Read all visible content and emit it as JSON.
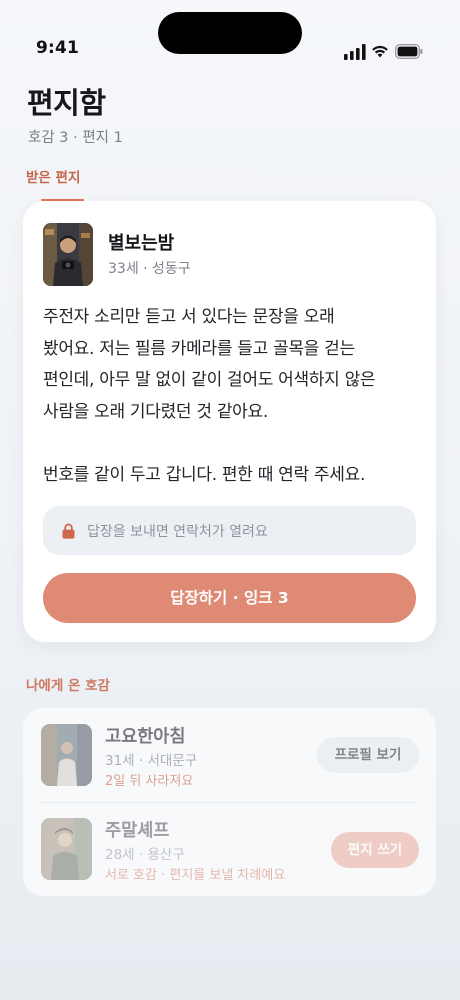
{
  "status_bar": {
    "time": "9:41"
  },
  "header": {
    "title": "편지함",
    "subtitle": "호감 3 · 편지 1"
  },
  "received_section": {
    "label": "받은 편지"
  },
  "letter": {
    "sender": {
      "name": "별보는밤",
      "meta": "33세 · 성동구",
      "avatar": "person-photo"
    },
    "paragraph1": [
      "주전자 소리만 듣고 서 있다는 문장을 오래",
      "봤어요. 저는 필름 카메라를 들고 골목을 걷는",
      "편인데, 아무 말 없이 같이 걸어도 어색하지 않은",
      "사람을 오래 기다렸던 것 같아요."
    ],
    "paragraph2": "번호를 같이 두고 갑니다. 편한 때 연락 주세요.",
    "locked_note": "답장을 보내면 연락처가 열려요",
    "lock_icon": "lock-icon",
    "reply_button": "답장하기 · 잉크 3",
    "accent_color": "#df8a74"
  },
  "likes_section": {
    "label": "나에게 온 호감",
    "items": [
      {
        "name": "고요한아침",
        "meta": "31세 · 서대문구",
        "note": "2일 뒤 사라져요",
        "action": "프로필 보기"
      },
      {
        "name": "주말셰프",
        "meta": "28세 · 용산구",
        "note": "서로 호감 · 편지를 보낼 차례예요",
        "action": "편지 쓰기"
      }
    ]
  }
}
